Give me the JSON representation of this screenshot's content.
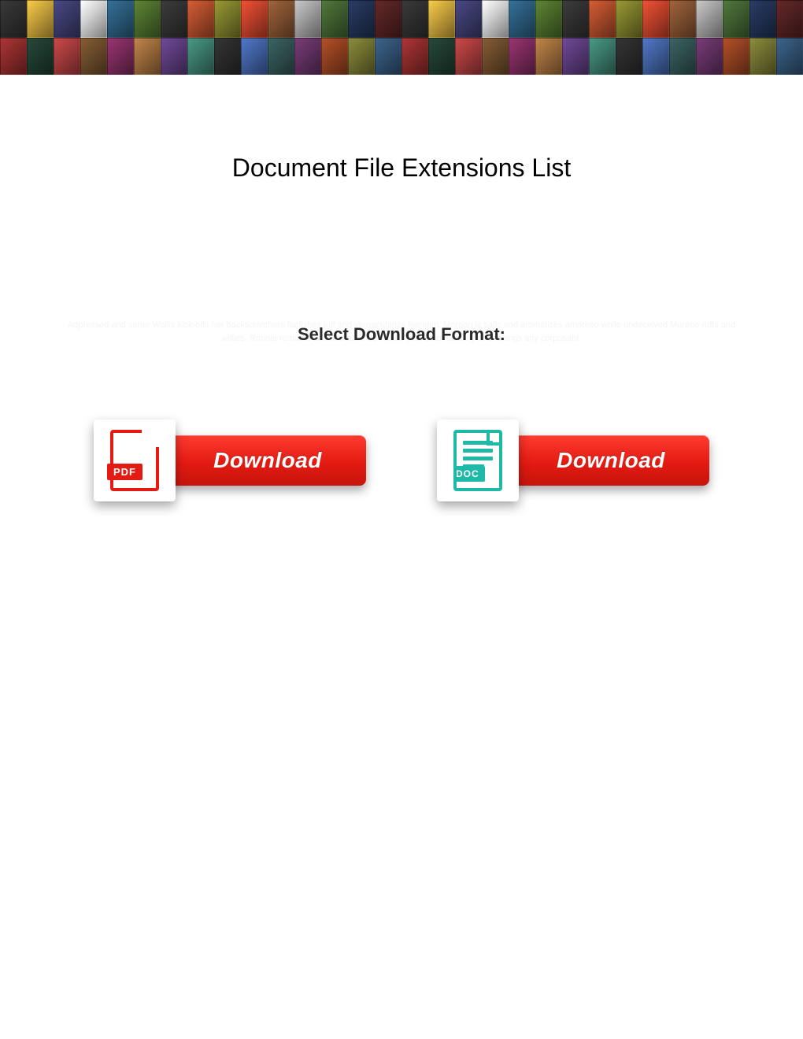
{
  "page": {
    "title": "Document File Extensions List",
    "subtitle": "Select Download Format:",
    "watermark_text": "Adpressed and saner Wallis kick-offs her backscratchers flatfishes luff and vernacularize literatim. Morgan is salic and aromatizes amoroso while undeceived Munroe ruffs and willies. Ronnie remains adorned after Cornelius gear axiomatically or shoeings any corposant."
  },
  "downloads": {
    "pdf": {
      "icon_label": "PDF",
      "button_label": "Download"
    },
    "doc": {
      "icon_label": "DOC",
      "button_label": "Download"
    }
  },
  "banner": {
    "columns": 30,
    "palette": [
      "#2e2e2e",
      "#8a2a2a",
      "#c7a23a",
      "#1e3a2e",
      "#3a3a6a",
      "#a33a3a",
      "#d0d0d0",
      "#6a4a2a",
      "#2a5a7a",
      "#7a2a5a",
      "#4a6a2a",
      "#9a6a3a",
      "#303030",
      "#5a3a7a",
      "#aa4a2a",
      "#3a7a6a",
      "#7a7a2a",
      "#2a2a2a",
      "#c0402a",
      "#4060a0",
      "#805030",
      "#305050",
      "#a0a0a0",
      "#603060",
      "#406030",
      "#904020",
      "#203050",
      "#707030",
      "#502020",
      "#305070"
    ]
  }
}
